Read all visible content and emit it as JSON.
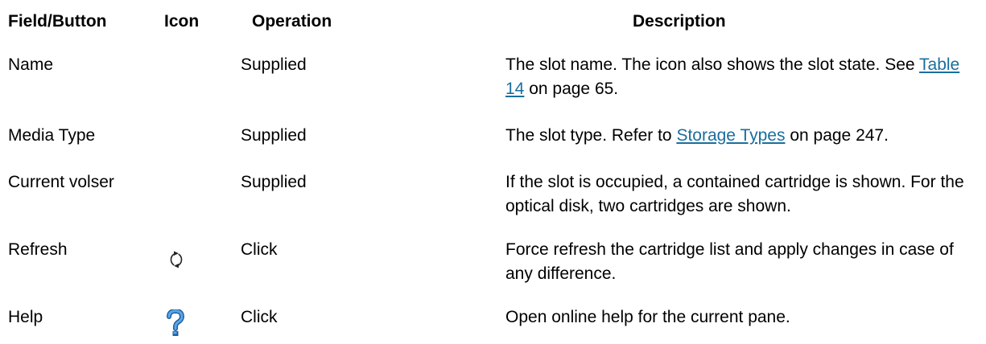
{
  "headers": {
    "field": "Field/Button",
    "icon": "Icon",
    "operation": "Operation",
    "description": "Description"
  },
  "rows": [
    {
      "field": "Name",
      "operation": "Supplied",
      "desc_pre": "The slot name. The icon also shows the slot state. See ",
      "desc_link": "Table 14",
      "desc_post": " on page 65."
    },
    {
      "field": "Media Type",
      "operation": "Supplied",
      "desc_pre": "The slot type. Refer to ",
      "desc_link": "Storage Types",
      "desc_post": " on page 247."
    },
    {
      "field": "Current volser",
      "operation": "Supplied",
      "desc_line1": "If the slot is occupied, a contained cartridge is shown. For the",
      "desc_line2": "optical disk, two cartridges are shown."
    },
    {
      "field": "Refresh",
      "icon": "refresh-icon",
      "operation": "Click",
      "desc_line1": "Force refresh the cartridge list and apply changes in case of",
      "desc_line2": "any difference."
    },
    {
      "field": "Help",
      "icon": "help-icon",
      "operation": "Click",
      "desc_line1": "Open online help for the current pane."
    }
  ],
  "colors": {
    "link": "#1a6e9e",
    "help_icon": "#3a7fc4"
  }
}
